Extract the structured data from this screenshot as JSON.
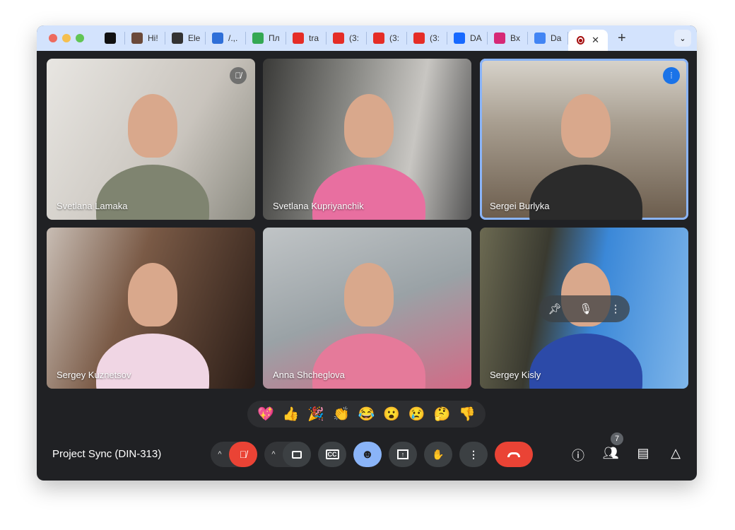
{
  "tabs": [
    {
      "label": "",
      "icon": "pscs-icon",
      "color": "#111"
    },
    {
      "label": "Hi!",
      "icon": "avatar-icon",
      "color": "#6b4a3a"
    },
    {
      "label": "Ele",
      "icon": "eye-icon",
      "color": "#333"
    },
    {
      "label": "/.,.",
      "icon": "diagonal-icon",
      "color": "#2f6fd8"
    },
    {
      "label": "Пл",
      "icon": "plus-sheet-icon",
      "color": "#34a853"
    },
    {
      "label": "tra",
      "icon": "youtube-icon",
      "color": "#e52d27"
    },
    {
      "label": "(3:",
      "icon": "youtube-icon",
      "color": "#e52d27"
    },
    {
      "label": "(3:",
      "icon": "youtube-icon",
      "color": "#e52d27"
    },
    {
      "label": "(3:",
      "icon": "youtube-icon",
      "color": "#e52d27"
    },
    {
      "label": "DA",
      "icon": "behance-icon",
      "color": "#1769ff"
    },
    {
      "label": "Bx",
      "icon": "instagram-icon",
      "color": "#d62976"
    },
    {
      "label": "Da",
      "icon": "calendar-icon",
      "color": "#4285f4"
    }
  ],
  "participants": [
    {
      "name": "Svetlana Lamaka"
    },
    {
      "name": "Svetlana Kupriyanchik"
    },
    {
      "name": "Sergei Burlyka"
    },
    {
      "name": "Sergey Kuznetsov"
    },
    {
      "name": "Anna Shcheglova"
    },
    {
      "name": "Sergey Kisly"
    }
  ],
  "reactions": [
    "💖",
    "👍",
    "🎉",
    "👏",
    "😂",
    "😮",
    "😢",
    "🤔",
    "👎"
  ],
  "meeting_title": "Project Sync (DIN-313)",
  "participant_count": "7",
  "accent": "#8ab4f8"
}
